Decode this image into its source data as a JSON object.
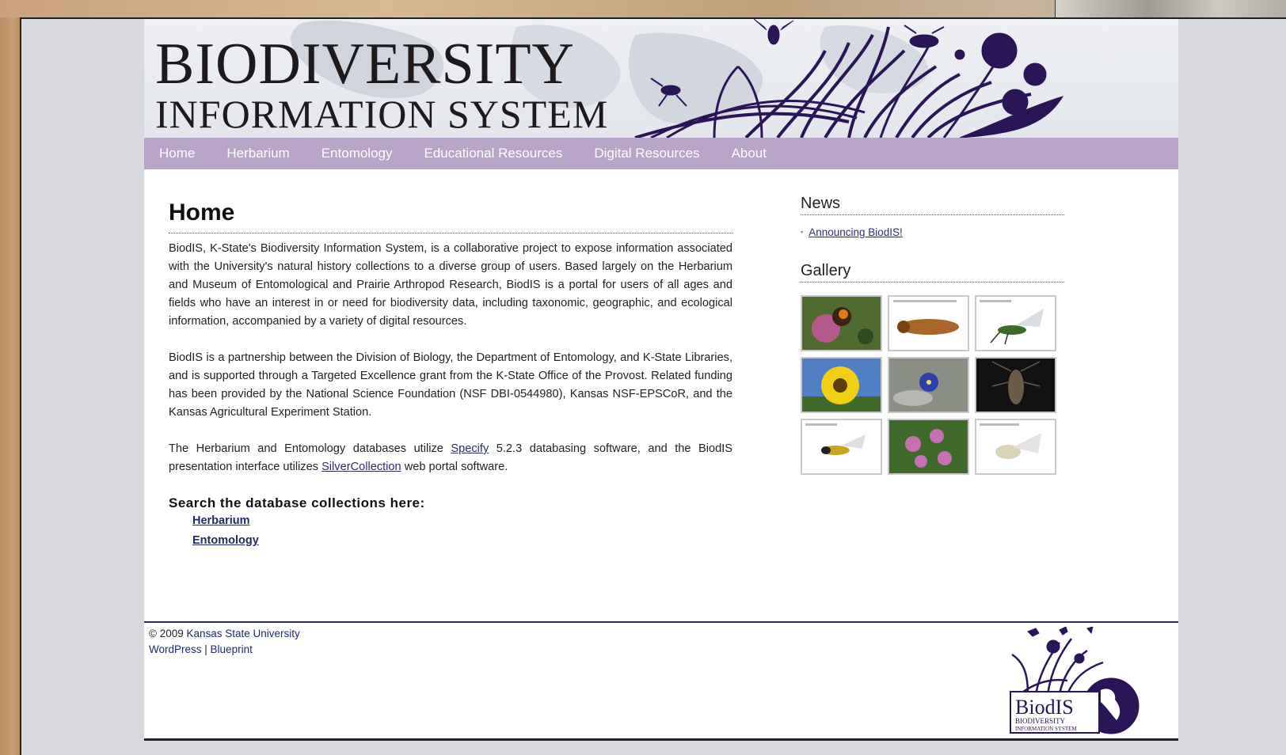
{
  "header": {
    "title_line1": "BIODIVERSITY",
    "title_line2": "INFORMATION SYSTEM"
  },
  "nav": {
    "items": [
      "Home",
      "Herbarium",
      "Entomology",
      "Educational Resources",
      "Digital Resources",
      "About"
    ]
  },
  "main": {
    "title": "Home",
    "p1": "BiodIS, K-State's Biodiversity Information System, is a collaborative project to expose information associated with the University's natural history collections to a diverse group of users. Based largely on the Herbarium and Museum of Entomological and Prairie Arthropod Research, BiodIS is a portal for users of all ages and fields who have an interest in or need for biodiversity data, including taxonomic, geographic, and ecological information, accompanied by a variety of digital resources.",
    "p2": "BiodIS is a partnership between the Division of Biology, the Department of Entomology, and K-State Libraries, and is supported through a Targeted Excellence grant from the K-State Office of the Provost. Related funding has been provided by the National Science Foundation (NSF DBI-0544980), Kansas NSF-EPSCoR, and the Kansas Agricultural Experiment Station.",
    "p3_before": "The Herbarium and Entomology databases utilize ",
    "p3_link1": "Specify",
    "p3_middle": " 5.2.3 databasing software, and the BiodIS presentation interface utilizes ",
    "p3_link2": "SilverCollection",
    "p3_after": " web portal software.",
    "search_heading": "Search the database collections here:",
    "search_links": [
      "Herbarium",
      "Entomology"
    ]
  },
  "sidebar": {
    "news_title": "News",
    "news_items": [
      "Announcing BiodIS!"
    ],
    "gallery_title": "Gallery"
  },
  "footer": {
    "copyright": "© 2009 ",
    "university": "Kansas State University",
    "wordpress": "WordPress",
    "separator": " | ",
    "blueprint": "Blueprint"
  },
  "logo": {
    "name": "BiodIS",
    "tagline_1": "BIODIVERSITY",
    "tagline_2": "INFORMATION SYSTEM"
  },
  "colors": {
    "nav_bg": "#b9a5c9",
    "link": "#2a2e78",
    "silhouette": "#2a1558"
  }
}
